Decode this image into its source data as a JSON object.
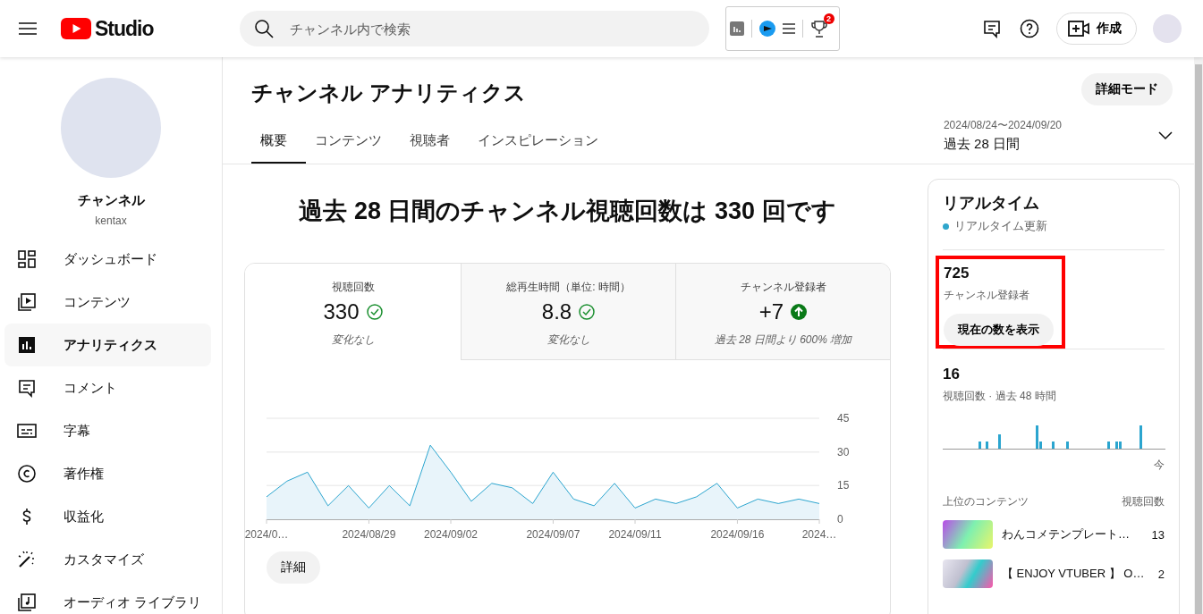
{
  "header": {
    "logo": "Studio",
    "search": {
      "placeholder": "チャンネル内で検索"
    },
    "extension_badge": "2",
    "create_button": "作成"
  },
  "sidebar": {
    "channel_name": "チャンネル",
    "handle": "kentax",
    "items": [
      {
        "kind": "dashboard",
        "label": "ダッシュボード",
        "selected": false
      },
      {
        "kind": "content",
        "label": "コンテンツ",
        "selected": false
      },
      {
        "kind": "analytics",
        "label": "アナリティクス",
        "selected": true
      },
      {
        "kind": "comments",
        "label": "コメント",
        "selected": false
      },
      {
        "kind": "subtitles",
        "label": "字幕",
        "selected": false
      },
      {
        "kind": "copyright",
        "label": "著作権",
        "selected": false
      },
      {
        "kind": "earn",
        "label": "収益化",
        "selected": false
      },
      {
        "kind": "customize",
        "label": "カスタマイズ",
        "selected": false
      },
      {
        "kind": "audio",
        "label": "オーディオ ライブラリ",
        "selected": false
      }
    ]
  },
  "page": {
    "title": "チャンネル アナリティクス",
    "advanced_button": "詳細モード",
    "date_range": "2024/08/24〜2024/09/20",
    "period": "過去 28 日間",
    "tabs": [
      {
        "label": "概要",
        "selected": true
      },
      {
        "label": "コンテンツ",
        "selected": false
      },
      {
        "label": "視聴者",
        "selected": false
      },
      {
        "label": "インスピレーション",
        "selected": false
      }
    ]
  },
  "overview": {
    "headline": "過去 28 日間のチャンネル視聴回数は 330 回です",
    "metrics": [
      {
        "label": "視聴回数",
        "value": "330",
        "increased": false,
        "note": "変化なし",
        "selected": true
      },
      {
        "label": "総再生時間（単位: 時間）",
        "value": "8.8",
        "increased": false,
        "note": "変化なし",
        "selected": false
      },
      {
        "label": "チャンネル登録者",
        "value": "+7",
        "increased": true,
        "note": "過去 28 日間より 600% 増加",
        "selected": false
      }
    ],
    "chart_data": {
      "type": "area",
      "values": [
        10,
        17,
        21,
        6,
        15,
        5,
        15,
        6,
        33,
        21,
        8,
        16,
        14,
        7,
        21,
        9,
        6,
        16,
        5,
        9,
        7,
        10,
        16,
        5,
        9,
        7,
        9,
        7
      ],
      "ylim": [
        0,
        45
      ],
      "yticks": [
        0,
        15,
        30,
        45
      ],
      "categories": [
        "2024/0…",
        null,
        null,
        null,
        null,
        "2024/08/29",
        null,
        null,
        null,
        "2024/09/02",
        null,
        null,
        null,
        null,
        "2024/09/07",
        null,
        null,
        null,
        "2024/09/11",
        null,
        null,
        null,
        null,
        "2024/09/16",
        null,
        null,
        null,
        "2024…"
      ]
    },
    "details_button": "詳細"
  },
  "realtime": {
    "title": "リアルタイム",
    "live_label": "リアルタイム更新",
    "subscribers": "725",
    "subscribers_label": "チャンネル登録者",
    "show_count_button": "現在の数を表示",
    "views": "16",
    "views_label": "視聴回数 · 過去 48 時間",
    "now_label": "今",
    "top_header": "上位のコンテンツ",
    "views_header": "視聴回数",
    "top_content": [
      {
        "title": "わんコメテンプレート…",
        "views": "13"
      },
      {
        "title": "【 ENJOY VTUBER 】 O…",
        "views": "2"
      }
    ]
  }
}
